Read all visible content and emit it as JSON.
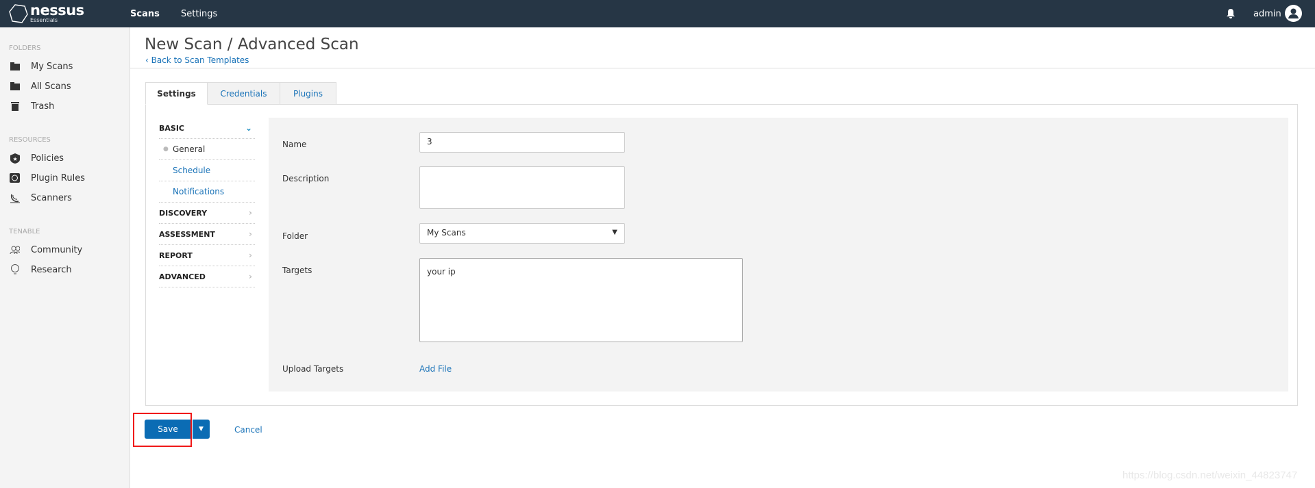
{
  "header": {
    "logo_name": "nessus",
    "logo_sub": "Essentials",
    "nav": [
      "Scans",
      "Settings"
    ],
    "user": "admin"
  },
  "sidebar": {
    "sections": [
      {
        "title": "FOLDERS",
        "items": [
          "My Scans",
          "All Scans",
          "Trash"
        ]
      },
      {
        "title": "RESOURCES",
        "items": [
          "Policies",
          "Plugin Rules",
          "Scanners"
        ]
      },
      {
        "title": "TENABLE",
        "items": [
          "Community",
          "Research"
        ]
      }
    ]
  },
  "page": {
    "title": "New Scan / Advanced Scan",
    "back_link": "Back to Scan Templates"
  },
  "tabs": [
    "Settings",
    "Credentials",
    "Plugins"
  ],
  "left_nav": {
    "basic": "BASIC",
    "basic_items": [
      "General",
      "Schedule",
      "Notifications"
    ],
    "sections": [
      "DISCOVERY",
      "ASSESSMENT",
      "REPORT",
      "ADVANCED"
    ]
  },
  "form": {
    "name_label": "Name",
    "name_value": "3",
    "description_label": "Description",
    "description_value": "",
    "folder_label": "Folder",
    "folder_value": "My Scans",
    "targets_label": "Targets",
    "targets_value": "your ip",
    "upload_label": "Upload Targets",
    "upload_link": "Add File"
  },
  "actions": {
    "save": "Save",
    "cancel": "Cancel"
  },
  "watermark": "https://blog.csdn.net/weixin_44823747",
  "colors": {
    "topbar": "#263645",
    "accent": "#0b6cb4",
    "link": "#1a73b8",
    "highlight": "#f01818"
  }
}
